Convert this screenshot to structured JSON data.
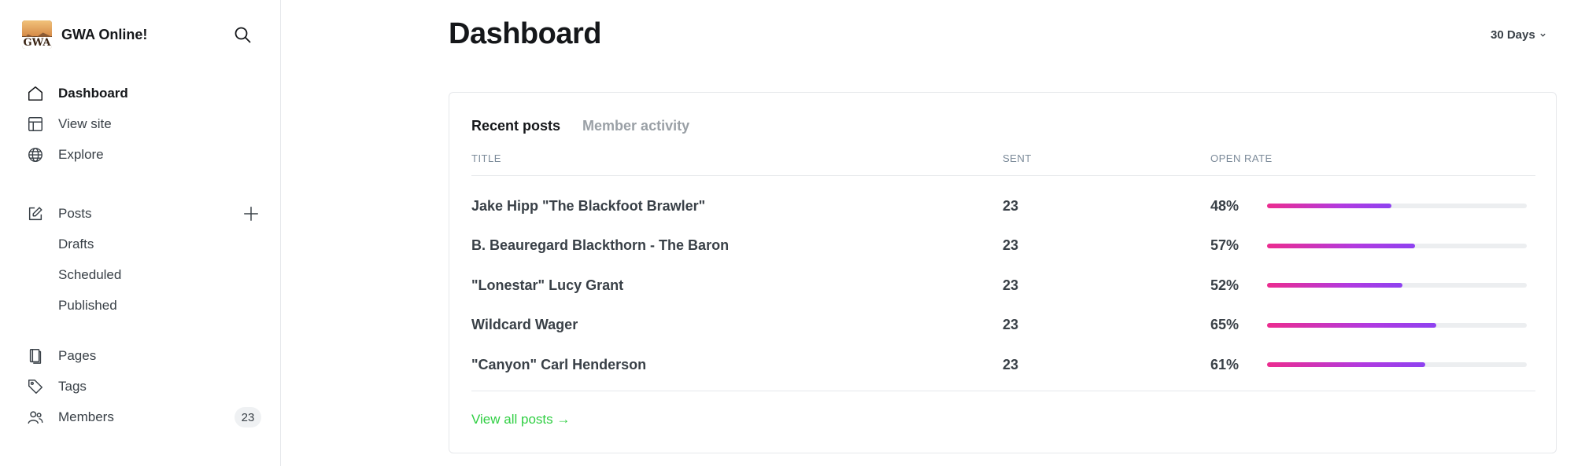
{
  "site": {
    "name": "GWA Online!",
    "logo_text": "GWA"
  },
  "sidebar": {
    "primary": [
      {
        "label": "Dashboard",
        "icon": "home-icon",
        "active": true
      },
      {
        "label": "View site",
        "icon": "layout-icon"
      },
      {
        "label": "Explore",
        "icon": "globe-icon"
      }
    ],
    "posts": {
      "label": "Posts",
      "icon": "edit-icon",
      "subitems": [
        "Drafts",
        "Scheduled",
        "Published"
      ]
    },
    "secondary": [
      {
        "label": "Pages",
        "icon": "pages-icon"
      },
      {
        "label": "Tags",
        "icon": "tag-icon"
      },
      {
        "label": "Members",
        "icon": "members-icon",
        "count": "23"
      }
    ]
  },
  "header": {
    "title": "Dashboard",
    "range": "30 Days"
  },
  "card": {
    "tabs": [
      "Recent posts",
      "Member activity"
    ],
    "columns": {
      "title": "TITLE",
      "sent": "SENT",
      "open_rate": "OPEN RATE"
    },
    "rows": [
      {
        "title": "Jake Hipp \"The Blackfoot Brawler\"",
        "sent": "23",
        "open_rate": "48%",
        "rate_value": 48
      },
      {
        "title": "B. Beauregard Blackthorn - The Baron",
        "sent": "23",
        "open_rate": "57%",
        "rate_value": 57
      },
      {
        "title": "\"Lonestar\" Lucy Grant",
        "sent": "23",
        "open_rate": "52%",
        "rate_value": 52
      },
      {
        "title": "Wildcard Wager",
        "sent": "23",
        "open_rate": "65%",
        "rate_value": 65
      },
      {
        "title": "\"Canyon\" Carl Henderson",
        "sent": "23",
        "open_rate": "61%",
        "rate_value": 61
      }
    ],
    "view_all": "View all posts →"
  },
  "colors": {
    "accent_green": "#30cf43",
    "bar_start": "#ec2c8f",
    "bar_end": "#8e42f0",
    "bar_track": "#eceef0"
  }
}
